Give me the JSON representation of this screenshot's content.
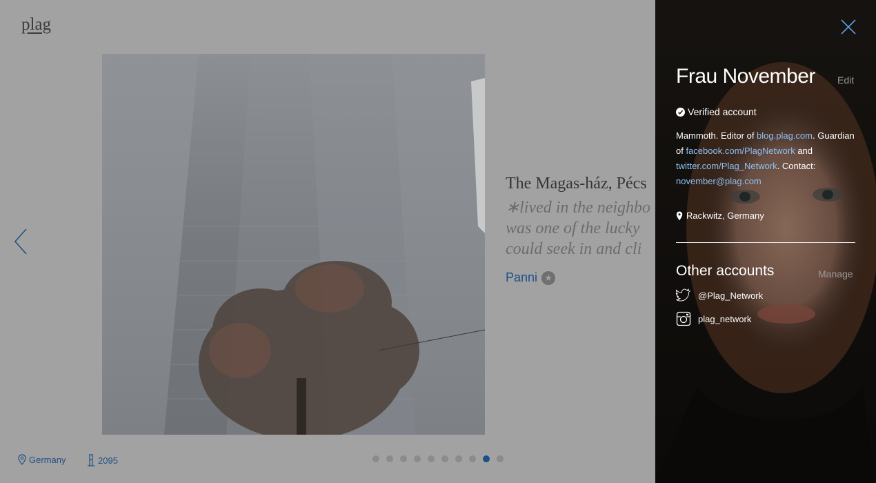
{
  "header": {
    "logo": "plag"
  },
  "story": {
    "title": "The Magas-ház, Pécs",
    "text_lines": [
      "∗lived in the neighbo",
      "was one of the lucky",
      "could seek in and cli"
    ],
    "author": "Panni"
  },
  "footer": {
    "location": "Germany",
    "views": "2095",
    "dots_total": 10,
    "dots_active_index": 8
  },
  "profile": {
    "name": "Frau November",
    "edit_label": "Edit",
    "verified_label": "Verified account",
    "bio": {
      "t1": "Mammoth. Editor of ",
      "link1": "blog.plag.com",
      "t2": ". Guardian of ",
      "link2": "facebook.com/PlagNetwork",
      "t3": " and ",
      "link3": "twitter.com/Plag_Network",
      "t4": ". Contact: ",
      "link4": "november@plag.com"
    },
    "location": "Rackwitz, Germany",
    "other_accounts_title": "Other accounts",
    "manage_label": "Manage",
    "accounts": [
      {
        "icon": "twitter-icon",
        "handle": "@Plag_Network"
      },
      {
        "icon": "instagram-icon",
        "handle": "plag_network"
      }
    ]
  },
  "colors": {
    "link_dimmed": "#1f4f86",
    "link_panel": "#8cc0f2",
    "active_dot": "#1b4f8a"
  }
}
